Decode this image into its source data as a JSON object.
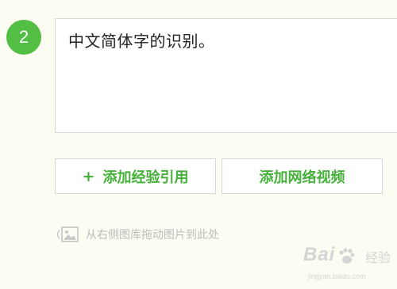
{
  "step": {
    "number": "2"
  },
  "editor": {
    "content": "中文简体字的识别。"
  },
  "buttons": {
    "add_reference": {
      "prefix": "+",
      "label": "添加经验引用"
    },
    "add_video": {
      "label": "添加网络视频"
    }
  },
  "drag_hint": {
    "text": "从右侧图库拖动图片到此处",
    "icon": "image-icon"
  },
  "watermark": {
    "brand": "Bai",
    "label": "经验",
    "url": "jingyan.baidu.com"
  },
  "colors": {
    "accent": "#52be43",
    "button_text": "#46b13a",
    "background": "#fdfcf2",
    "border": "#d8d8d8"
  }
}
